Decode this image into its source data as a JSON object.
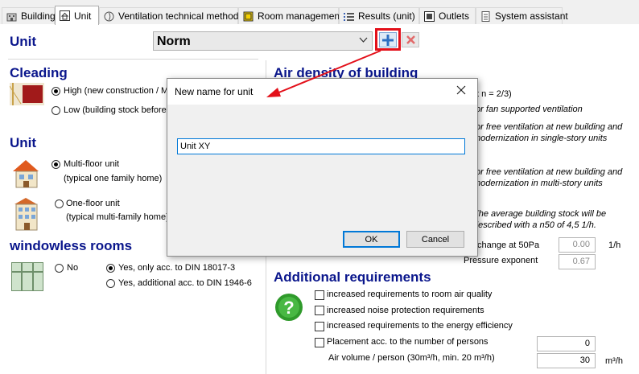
{
  "tabs": [
    {
      "label": "Building",
      "icon": "building-icon"
    },
    {
      "label": "Unit",
      "icon": "unit-icon",
      "active": true
    },
    {
      "label": "Ventilation technical methods",
      "icon": "ventilation-icon"
    },
    {
      "label": "Room management",
      "icon": "room-management-icon"
    },
    {
      "label": "Results (unit)",
      "icon": "results-list-icon"
    },
    {
      "label": "Outlets",
      "icon": "outlets-icon"
    },
    {
      "label": "System assistant",
      "icon": "system-assistant-icon"
    }
  ],
  "unit_header": {
    "title": "Unit",
    "selected_unit": "Norm"
  },
  "cleading": {
    "title": "Cleading",
    "options": [
      "High (new construction / M",
      "Low (building stock before"
    ]
  },
  "unit_type": {
    "title": "Unit",
    "multi_floor": {
      "line1": "Multi-floor unit",
      "line2": "(typical one family home)"
    },
    "one_floor": {
      "line1": "One-floor unit",
      "line2": "(typical multi-family home)"
    }
  },
  "windowless": {
    "title": "windowless rooms",
    "no": "No",
    "yes_only": "Yes, only acc. to DIN 18017-3",
    "yes_additional": "Yes, additional acc. to DIN 1946-6"
  },
  "air_density": {
    "title": "Air density of building",
    "partial_1": "t n = 2/3)",
    "note_1": "for fan supported ventilation",
    "note_2a": "for free ventilation at new building and",
    "note_2b": "modernization in single-story units",
    "note_3a": "for free ventilation at new building and",
    "note_3b": "modernization in multi-story units",
    "note_4a": "The average building stock will be",
    "note_4b": "described with a n50 of 4,5 1/h.",
    "change_label": "change at 50Pa",
    "change_value": "0.00",
    "change_unit": "1/h",
    "exponent_label": "Pressure exponent",
    "exponent_value": "0.67"
  },
  "additional": {
    "title": "Additional requirements",
    "items": [
      "increased requirements to room air quality",
      "increased noise protection requirements",
      "increased requirements to the energy efficiency",
      "Placement acc. to the number of persons"
    ],
    "persons_value": "0",
    "air_volume_label": "Air volume / person (30m³/h, min. 20 m³/h)",
    "air_volume_value": "30",
    "air_volume_unit": "m³/h"
  },
  "dialog": {
    "title": "New name for unit",
    "input_value": "Unit XY",
    "ok": "OK",
    "cancel": "Cancel"
  },
  "colors": {
    "heading": "#0a168c",
    "annotation": "#e3101a",
    "focus": "#0078d7"
  }
}
